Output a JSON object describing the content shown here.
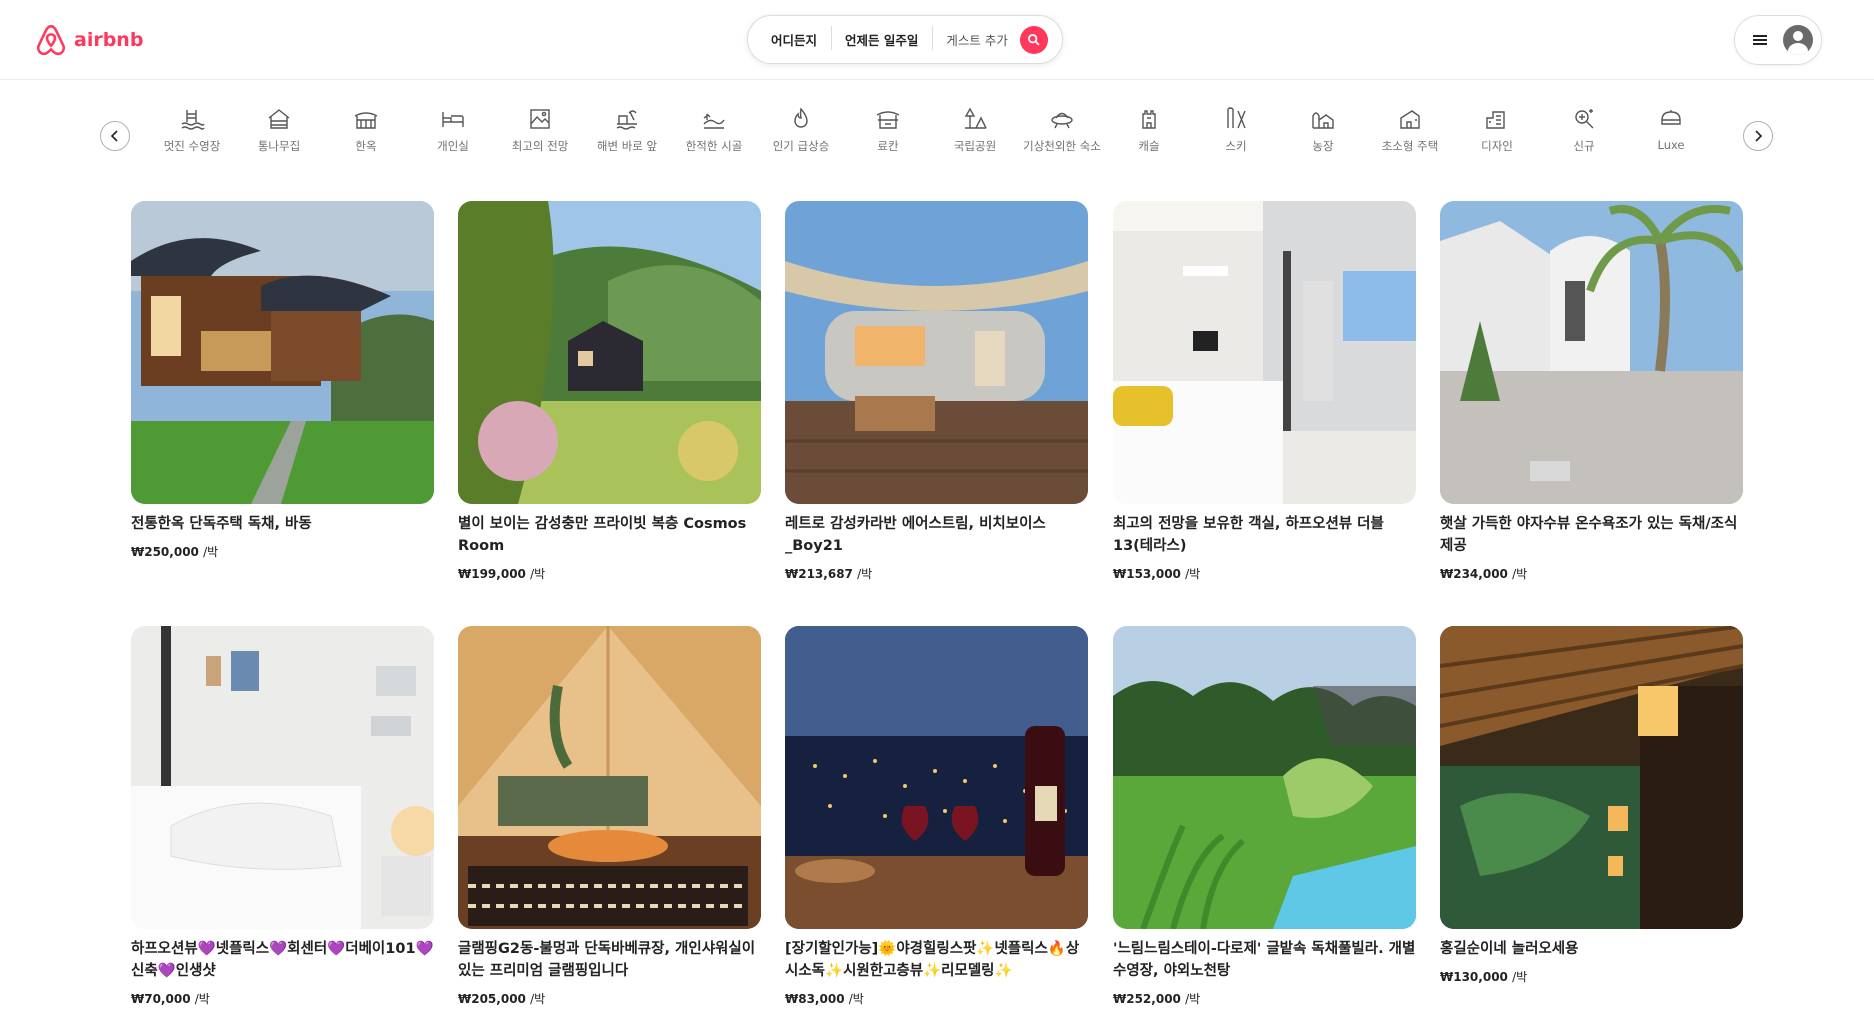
{
  "brand": {
    "name": "airbnb",
    "color": "#FF385C"
  },
  "search": {
    "where": "어디든지",
    "when": "언제든 일주일",
    "guests": "게스트 추가"
  },
  "categories": [
    "멋진 수영장",
    "통나무집",
    "한옥",
    "개인실",
    "최고의 전망",
    "해변 바로 앞",
    "한적한 시골",
    "인기 급상승",
    "료칸",
    "국립공원",
    "기상천외한 숙소",
    "캐슬",
    "스키",
    "농장",
    "초소형 주택",
    "디자인",
    "신규",
    "Luxe"
  ],
  "listings": [
    {
      "title": "전통한옥 단독주택 독채, 바동",
      "price": "₩250,000",
      "unit": "/박"
    },
    {
      "title": "별이 보이는 감성충만 프라이빗 복층 Cosmos Room",
      "price": "₩199,000",
      "unit": "/박"
    },
    {
      "title": "레트로 감성카라반 에어스트림, 비치보이스 _Boy21",
      "price": "₩213,687",
      "unit": "/박"
    },
    {
      "title": "최고의 전망을 보유한 객실, 하프오션뷰 더블13(테라스)",
      "price": "₩153,000",
      "unit": "/박"
    },
    {
      "title": "햇살 가득한 야자수뷰 온수욕조가 있는 독채/조식제공",
      "price": "₩234,000",
      "unit": "/박"
    },
    {
      "title": "하프오션뷰💜넷플릭스💜회센터💜더베이101💜신축💜인생샷",
      "price": "₩70,000",
      "unit": "/박"
    },
    {
      "title": "글램핑G2동-불멍과 단독바베큐장, 개인샤워실이 있는 프리미엄 글램핑입니다",
      "price": "₩205,000",
      "unit": "/박"
    },
    {
      "title": "[장기할인가능]🌞야경힐링스팟✨넷플릭스🔥상시소독✨시원한고층뷰✨리모델링✨",
      "price": "₩83,000",
      "unit": "/박"
    },
    {
      "title": "'느림느림스테이-다로제' 글밭속 독채풀빌라. 개별수영장, 야외노천탕",
      "price": "₩252,000",
      "unit": "/박"
    },
    {
      "title": "홍길순이네 놀러오세용",
      "price": "₩130,000",
      "unit": "/박"
    }
  ]
}
